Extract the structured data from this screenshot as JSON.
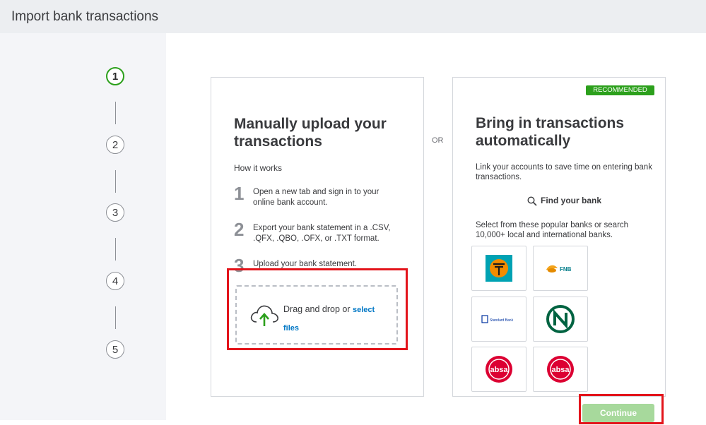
{
  "header": {
    "title": "Import bank transactions"
  },
  "stepper": {
    "steps": [
      "1",
      "2",
      "3",
      "4",
      "5"
    ]
  },
  "manual": {
    "title_line1": "Manually upload your",
    "title_line2": "transactions",
    "how_it_works": "How it works",
    "steps": [
      {
        "num": "1",
        "line1": "Open a new tab and sign in to your",
        "line2": "online bank account."
      },
      {
        "num": "2",
        "line1": "Export your bank statement in a .CSV,",
        "line2": ".QFX, .QBO, .OFX, or .TXT format."
      },
      {
        "num": "3",
        "line1": "Upload your bank statement.",
        "line2": ""
      }
    ],
    "dropzone": {
      "text": "Drag and drop or ",
      "link": "select files"
    }
  },
  "or_label": "OR",
  "auto": {
    "badge": "RECOMMENDED",
    "title_line1": "Bring in transactions",
    "title_line2": "automatically",
    "link_text": "Link your accounts to save time on entering bank transactions.",
    "find_bank": "Find your bank",
    "select_text": "Select from these popular banks or search 10,000+ local and international banks.",
    "banks": [
      "Capitec",
      "FNB",
      "Standard Bank",
      "Nedbank",
      "absa",
      "absa"
    ]
  },
  "continue_label": "Continue",
  "colors": {
    "accent": "#2ca01c",
    "link": "#0077c5",
    "highlight": "#e3141b"
  }
}
